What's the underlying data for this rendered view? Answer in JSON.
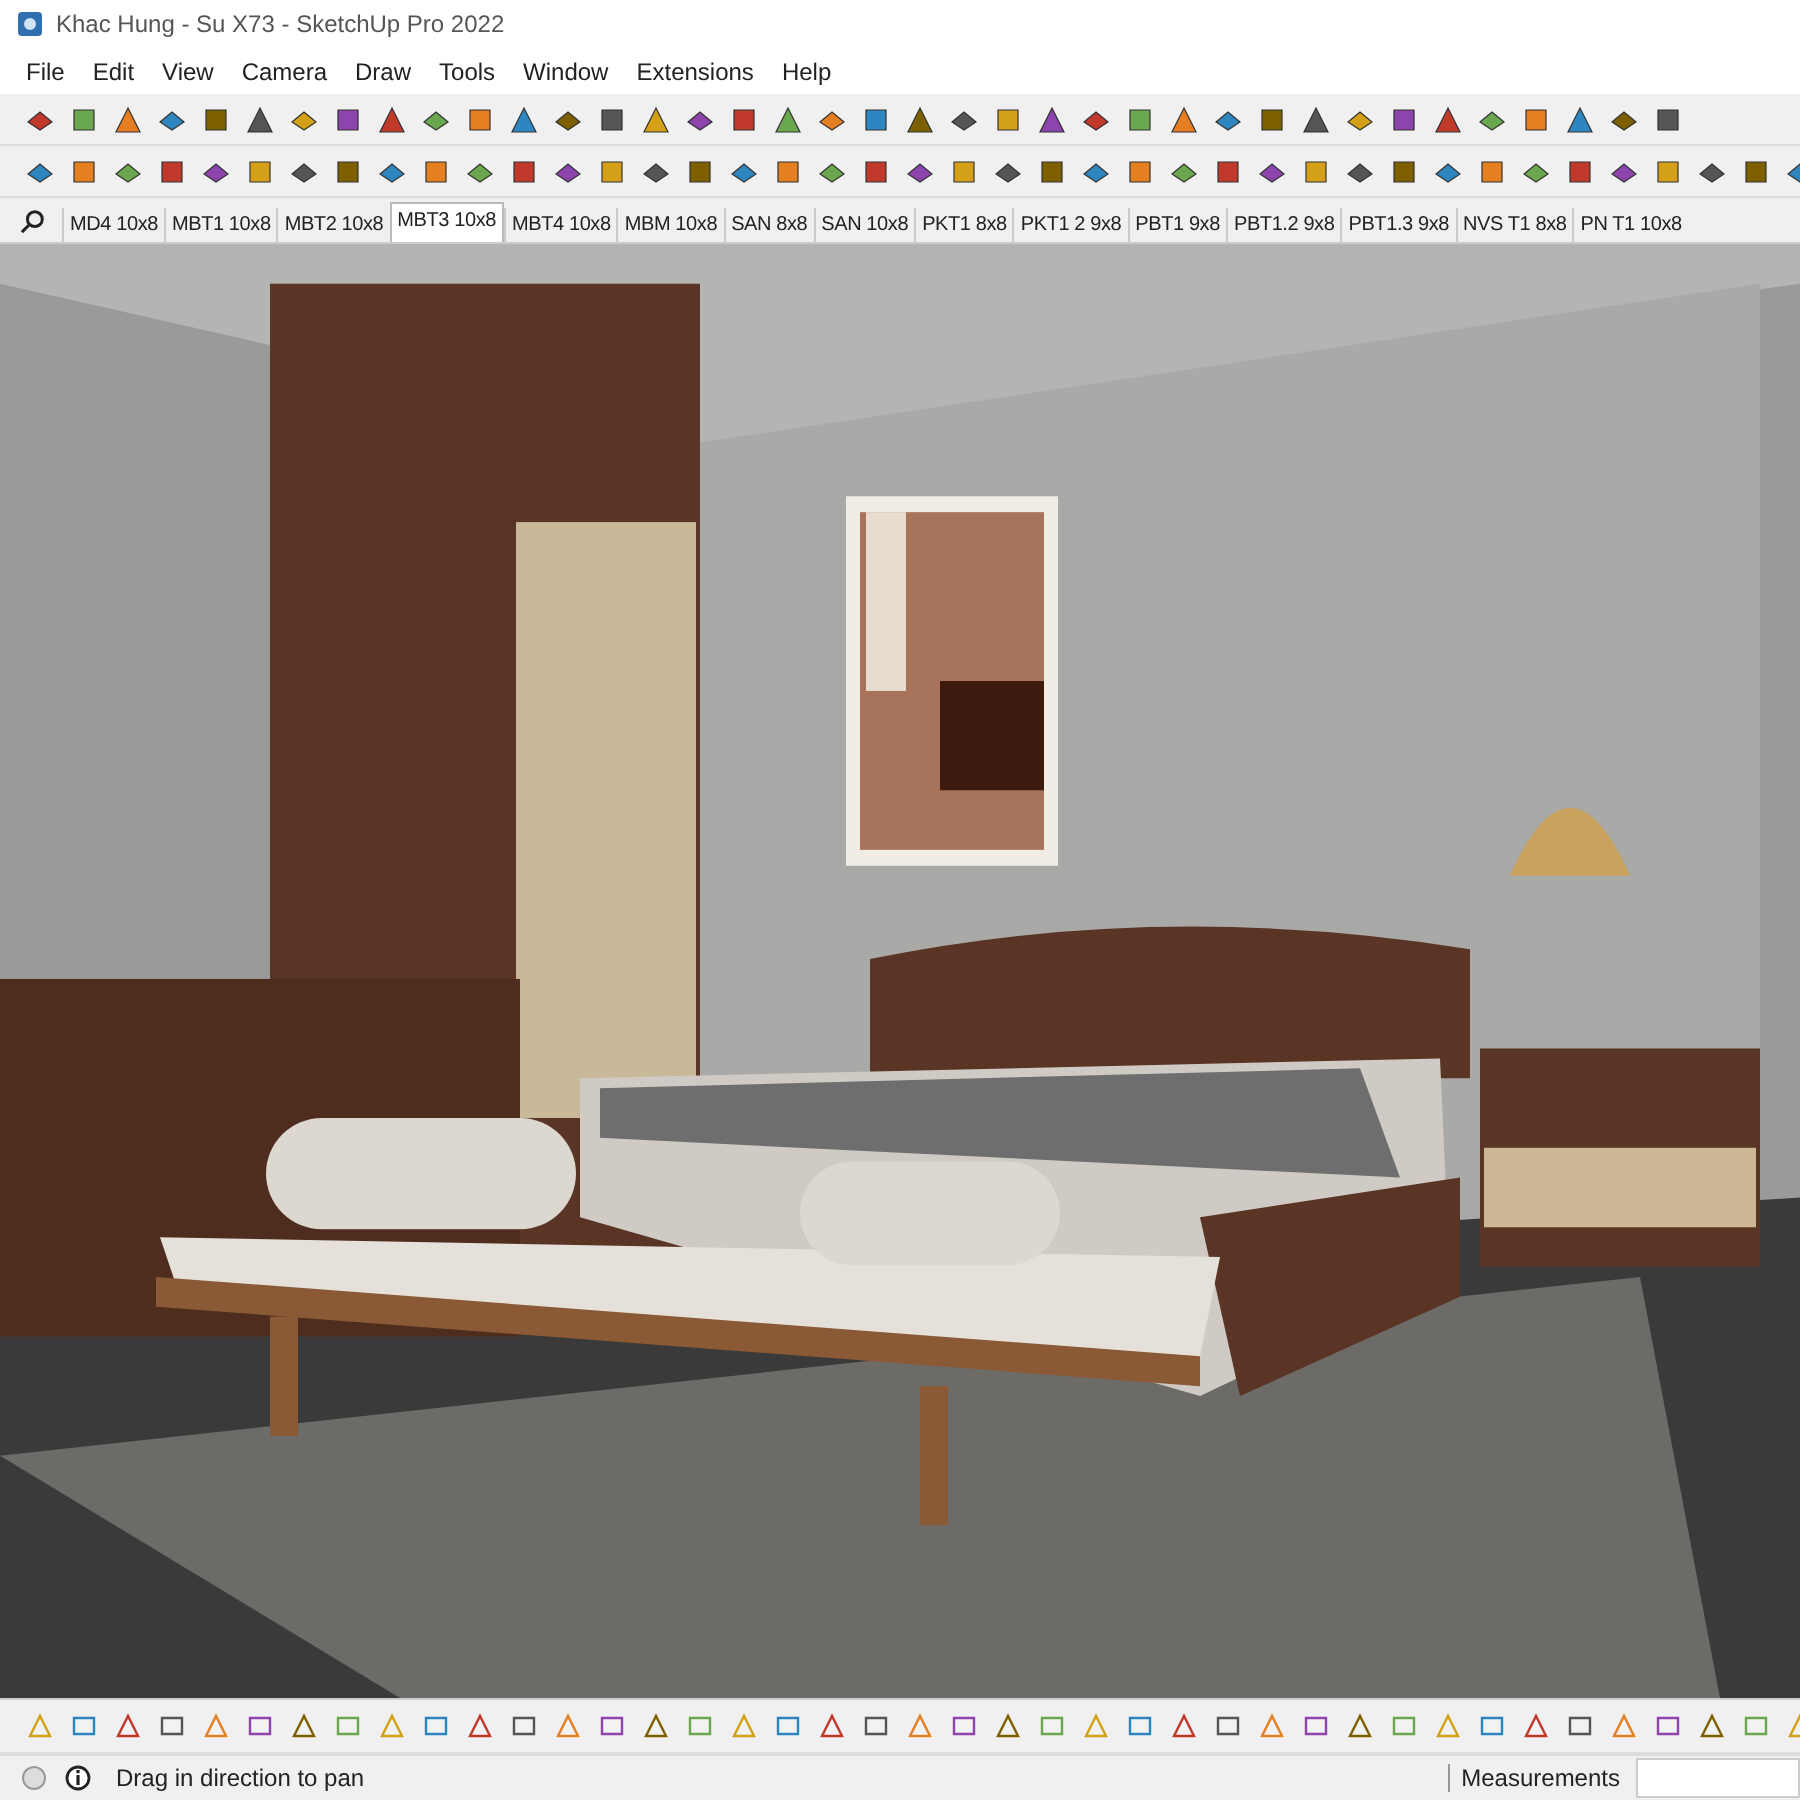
{
  "window": {
    "title": "Khac Hung - Su X73 - SketchUp Pro 2022"
  },
  "menu": [
    "File",
    "Edit",
    "View",
    "Camera",
    "Draw",
    "Tools",
    "Window",
    "Extensions",
    "Help"
  ],
  "scene_tabs": [
    {
      "label": "MD4 10x8",
      "selected": false
    },
    {
      "label": "MBT1 10x8",
      "selected": false
    },
    {
      "label": "MBT2 10x8",
      "selected": false
    },
    {
      "label": "MBT3 10x8",
      "selected": true
    },
    {
      "label": "MBT4 10x8",
      "selected": false
    },
    {
      "label": "MBM 10x8",
      "selected": false
    },
    {
      "label": "SAN 8x8",
      "selected": false
    },
    {
      "label": "SAN 10x8",
      "selected": false
    },
    {
      "label": "PKT1 8x8",
      "selected": false
    },
    {
      "label": "PKT1 2 9x8",
      "selected": false
    },
    {
      "label": "PBT1 9x8",
      "selected": false
    },
    {
      "label": "PBT1.2 9x8",
      "selected": false
    },
    {
      "label": "PBT1.3 9x8",
      "selected": false
    },
    {
      "label": "NVS T1 8x8",
      "selected": false
    },
    {
      "label": "PN T1 10x8",
      "selected": false
    }
  ],
  "status_bar": {
    "hint": "Drag in direction to pan",
    "measurements_label": "Measurements"
  }
}
